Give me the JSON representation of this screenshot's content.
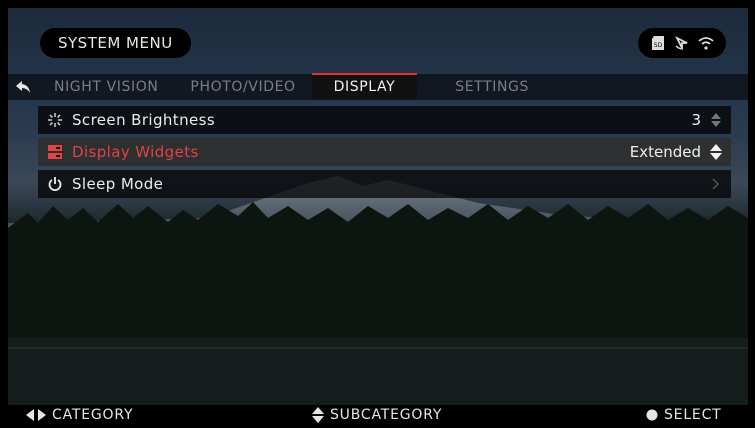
{
  "header": {
    "title": "SYSTEM MENU"
  },
  "status_icons": [
    "sd-card-icon",
    "gps-icon",
    "wifi-icon"
  ],
  "tabs": [
    {
      "label": "NIGHT VISION",
      "active": false
    },
    {
      "label": "PHOTO/VIDEO",
      "active": false
    },
    {
      "label": "DISPLAY",
      "active": true
    },
    {
      "label": "SETTINGS",
      "active": false
    }
  ],
  "menu": {
    "items": [
      {
        "icon": "brightness-icon",
        "label": "Screen Brightness",
        "value": "3",
        "control": "stepper"
      },
      {
        "icon": "widgets-icon",
        "label": "Display Widgets",
        "value": "Extended",
        "control": "stepper",
        "selected": true
      },
      {
        "icon": "power-icon",
        "label": "Sleep Mode",
        "value": "",
        "control": "chevron"
      }
    ]
  },
  "footer": {
    "category": "CATEGORY",
    "subcategory": "SUBCATEGORY",
    "select": "SELECT"
  },
  "colors": {
    "accent": "#d93535",
    "selected_text": "#e04444"
  }
}
